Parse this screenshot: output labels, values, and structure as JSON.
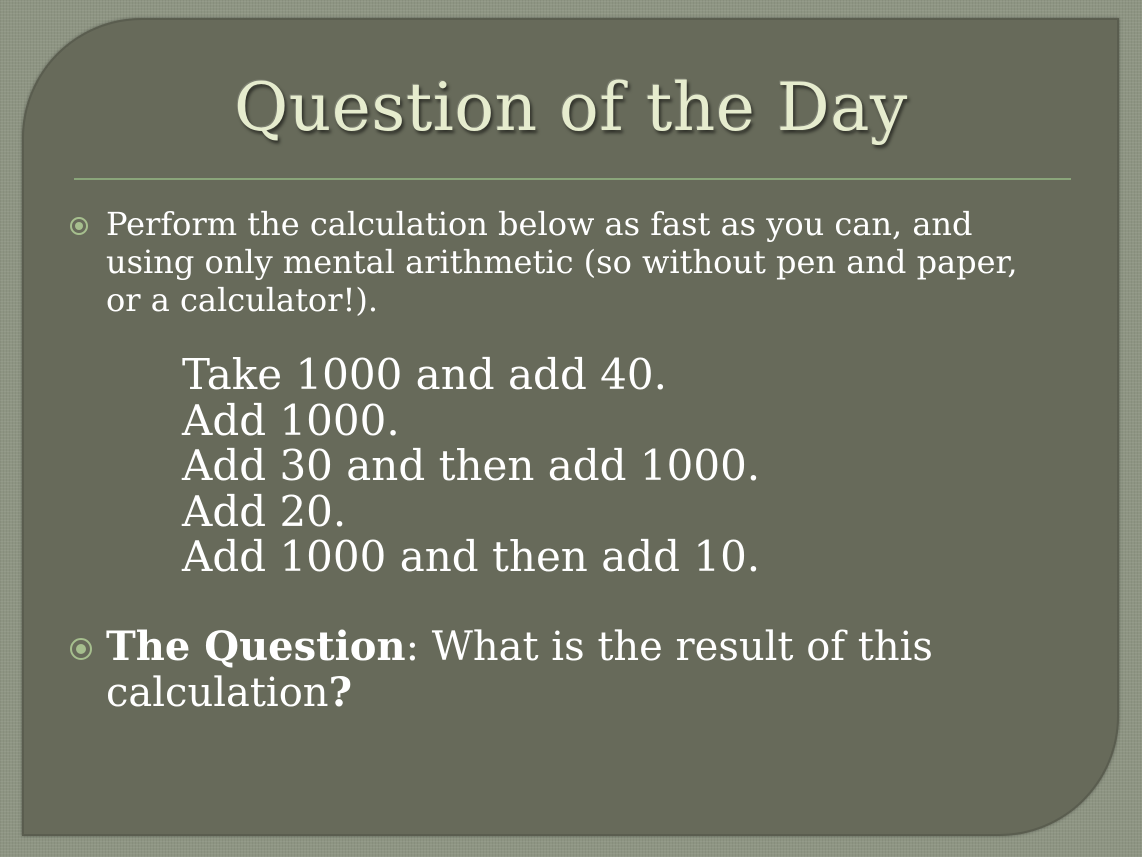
{
  "slide": {
    "title": "Question of the Day",
    "intro_bullet": "Perform the calculation below as fast as you can, and using only mental arithmetic (so without pen and paper, or a calculator!).",
    "steps": [
      "Take 1000 and add 40.",
      "Add 1000.",
      "Add 30 and then add 1000.",
      "Add 20.",
      "Add 1000 and then add 10."
    ],
    "question": {
      "label": "The Question",
      "separator": ":",
      "text": "What is the result of this calculation",
      "end_mark": "?"
    }
  },
  "colors": {
    "background": "#8e9583",
    "panel": "#676a5a",
    "title": "#e6ecce",
    "rule": "#8aa57a",
    "bullet_icon": "#a6bf8e",
    "text": "#ffffff"
  }
}
